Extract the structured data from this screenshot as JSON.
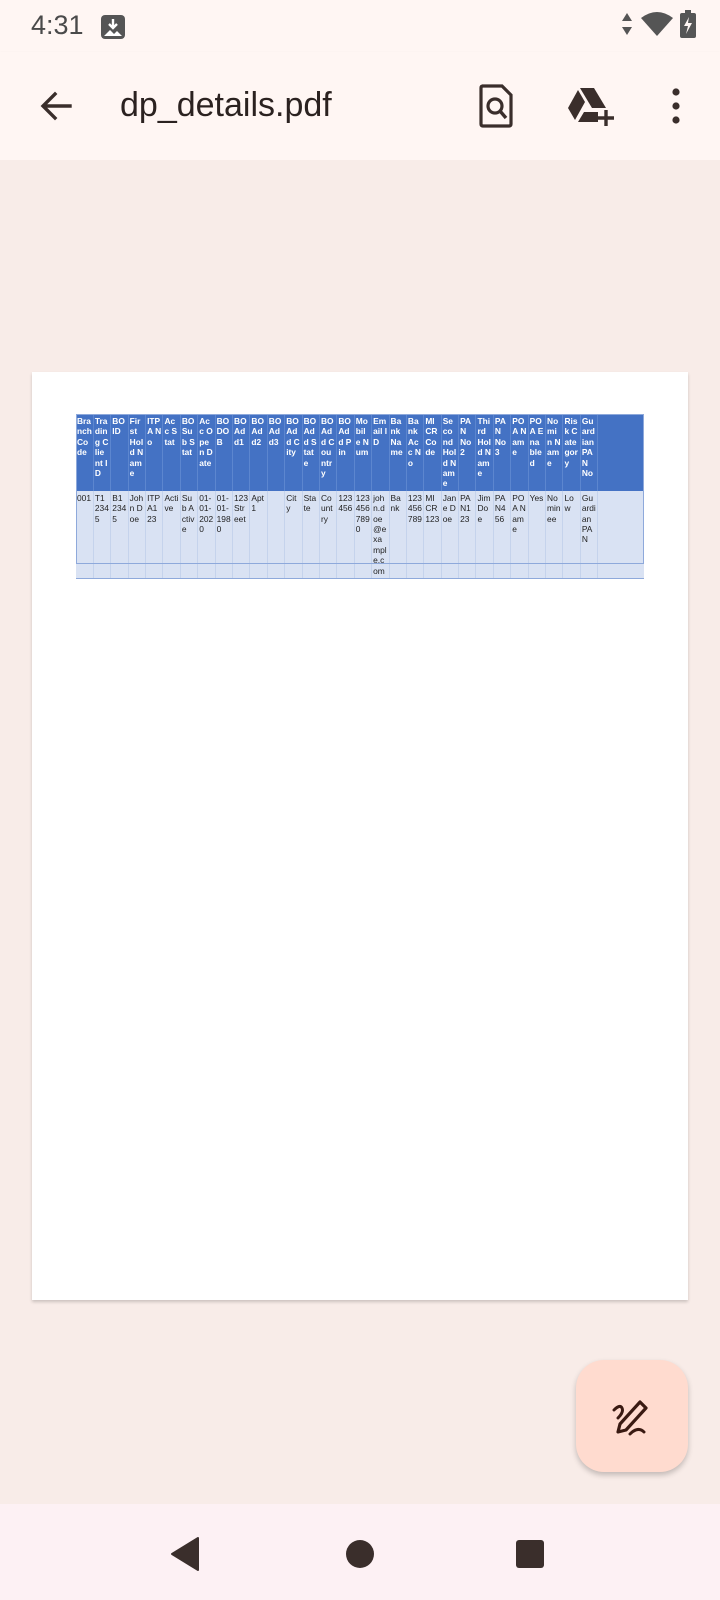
{
  "status_bar": {
    "time": "4:31",
    "icons": [
      "screenshot-notification-icon",
      "data-arrows-icon",
      "wifi-icon",
      "battery-icon"
    ]
  },
  "app_bar": {
    "title": "dp_details.pdf",
    "actions": [
      "back-arrow-icon",
      "find-in-document-icon",
      "add-to-drive-icon",
      "more-vert-icon"
    ]
  },
  "document": {
    "headers": [
      "Branch Code",
      "Trading Client ID",
      "BO ID",
      "First Hold Name",
      "ITPA No",
      "Acc Stat",
      "BO Sub Stat",
      "Acc Open Date",
      "BO DOB",
      "BO Add1",
      "BO Add2",
      "BO Add3",
      "BO Add City",
      "BO Add State",
      "BO Add Country",
      "BO Add Pin",
      "Mobile Num",
      "Email ID",
      "Bank Name",
      "Bank Acc No",
      "MICR Code",
      "Second Hold Name",
      "PAN No 2",
      "Third Hold Name",
      "PAN No 3",
      "POA Name",
      "POA Enabled",
      "Nomin Name",
      "Risk Category",
      "Guardian PAN No"
    ],
    "row": [
      "001",
      "T12345",
      "B12345",
      "John Doe",
      "ITPA123",
      "Active",
      "Sub Active",
      "01-01-2020",
      "01-01-1980",
      "123 Street",
      "Apt 1",
      "",
      "City",
      "State",
      "Country",
      "123456",
      "1234567890",
      "john.doe@example.com",
      "Bank",
      "123456789",
      "MICR123",
      "Jane Doe",
      "PAN123",
      "Jim Doe",
      "PAN456",
      "POA Name",
      "Yes",
      "Nominee",
      "Low",
      "Guardian PAN"
    ]
  },
  "fab": {
    "icon": "edit-pen-icon"
  },
  "nav_bar": {
    "icons": [
      "nav-back-icon",
      "nav-home-icon",
      "nav-recents-icon"
    ]
  },
  "colors": {
    "background": "#F8ECE8",
    "app_bar": "#FFF6F3",
    "table_header": "#4472C4",
    "table_row": "#D9E2F3",
    "fab": "#FFDBCF"
  }
}
